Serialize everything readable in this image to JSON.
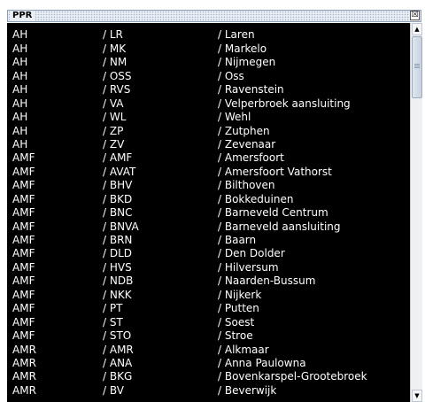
{
  "window": {
    "title": "PPR",
    "close_glyph": "☒"
  },
  "scroll": {
    "up_glyph": "▲",
    "down_glyph": "▼"
  },
  "rows": [
    {
      "a": "AH",
      "b": "/ LR",
      "c": "/ Laren"
    },
    {
      "a": "AH",
      "b": "/ MK",
      "c": "/ Markelo"
    },
    {
      "a": "AH",
      "b": "/ NM",
      "c": "/ Nijmegen"
    },
    {
      "a": "AH",
      "b": "/ OSS",
      "c": "/ Oss"
    },
    {
      "a": "AH",
      "b": "/ RVS",
      "c": "/ Ravenstein"
    },
    {
      "a": "AH",
      "b": "/ VA",
      "c": "/ Velperbroek aansluiting"
    },
    {
      "a": "AH",
      "b": "/ WL",
      "c": "/ Wehl"
    },
    {
      "a": "AH",
      "b": "/ ZP",
      "c": "/ Zutphen"
    },
    {
      "a": "AH",
      "b": "/ ZV",
      "c": "/ Zevenaar"
    },
    {
      "a": "AMF",
      "b": "/ AMF",
      "c": "/ Amersfoort"
    },
    {
      "a": "AMF",
      "b": "/ AVAT",
      "c": "/ Amersfoort Vathorst"
    },
    {
      "a": "AMF",
      "b": "/ BHV",
      "c": "/ Bilthoven"
    },
    {
      "a": "AMF",
      "b": "/ BKD",
      "c": "/ Bokkeduinen"
    },
    {
      "a": "AMF",
      "b": "/ BNC",
      "c": "/ Barneveld Centrum"
    },
    {
      "a": "AMF",
      "b": "/ BNVA",
      "c": "/ Barneveld aansluiting"
    },
    {
      "a": "AMF",
      "b": "/ BRN",
      "c": "/ Baarn"
    },
    {
      "a": "AMF",
      "b": "/ DLD",
      "c": "/ Den Dolder"
    },
    {
      "a": "AMF",
      "b": "/ HVS",
      "c": "/ Hilversum"
    },
    {
      "a": "AMF",
      "b": "/ NDB",
      "c": "/ Naarden-Bussum"
    },
    {
      "a": "AMF",
      "b": "/ NKK",
      "c": "/ Nijkerk"
    },
    {
      "a": "AMF",
      "b": "/ PT",
      "c": "/ Putten"
    },
    {
      "a": "AMF",
      "b": "/ ST",
      "c": "/ Soest"
    },
    {
      "a": "AMF",
      "b": "/ STO",
      "c": "/ Stroe"
    },
    {
      "a": "AMR",
      "b": "/ AMR",
      "c": "/ Alkmaar"
    },
    {
      "a": "AMR",
      "b": "/ ANA",
      "c": "/ Anna Paulowna"
    },
    {
      "a": "AMR",
      "b": "/ BKG",
      "c": "/ Bovenkarspel-Grootebroek"
    },
    {
      "a": "AMR",
      "b": "/ BV",
      "c": "/ Beverwijk"
    }
  ]
}
